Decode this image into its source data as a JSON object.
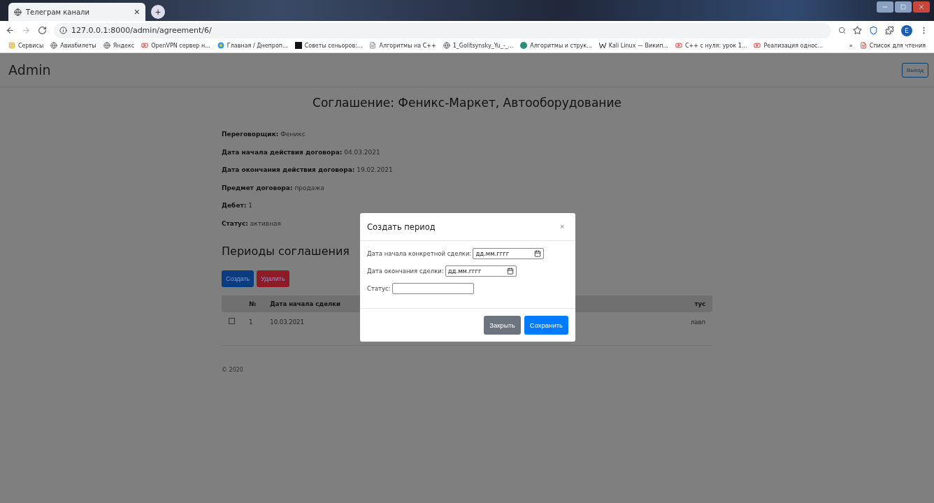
{
  "browser": {
    "tab": {
      "title": "Телеграм канали",
      "close": "×",
      "new_tab": "+"
    },
    "address": "127.0.0.1:8000/admin/agreement/6/",
    "bookmarks": [
      {
        "label": "Сервисы",
        "kind": "apps"
      },
      {
        "label": "Авиабилеты",
        "kind": "globe"
      },
      {
        "label": "Яндекс",
        "kind": "globe"
      },
      {
        "label": "OpenVPN сервер н...",
        "kind": "video"
      },
      {
        "label": "Главная / Днепроп...",
        "kind": "swirl"
      },
      {
        "label": "Советы сеньоров:...",
        "kind": "square"
      },
      {
        "label": "Алгоритмы на С++",
        "kind": "doc"
      },
      {
        "label": "1_Golitsynsky_Yu_-_...",
        "kind": "globe"
      },
      {
        "label": "Алгоритмы и струк...",
        "kind": "dot"
      },
      {
        "label": "Kali Linux — Викип...",
        "kind": "wiki"
      },
      {
        "label": "C++ с нуля: урок 1...",
        "kind": "video"
      },
      {
        "label": "Реализация однос...",
        "kind": "video"
      }
    ],
    "more": "»",
    "reading_list": "Список для чтения",
    "avatar": "E"
  },
  "navbar": {
    "brand": "Admin",
    "logout": "Выход"
  },
  "page": {
    "title": "Соглашение: Феникс-Маркет, Автооборудование",
    "fields": [
      {
        "label": "Переговорщик:",
        "value": "Феникс"
      },
      {
        "label": "Дата начала действия договора:",
        "value": "04.03.2021"
      },
      {
        "label": "Дата окончания действия договора:",
        "value": "19.02.2021"
      },
      {
        "label": "Предмет договора:",
        "value": "продажа"
      },
      {
        "label": "Дебет:",
        "value": "1"
      },
      {
        "label": "Статус:",
        "value": "активная"
      }
    ],
    "section_title": "Периоды соглашения",
    "buttons": [
      {
        "label": "Создать",
        "kind": "primary"
      },
      {
        "label": "Удалить",
        "kind": "danger"
      }
    ],
    "table": {
      "columns": [
        "№",
        "Дата начала сделки",
        "тус"
      ],
      "rows": [
        {
          "checked": false,
          "cells": [
            "1",
            "10.03.2021",
            "лавп"
          ]
        }
      ]
    },
    "footer": "© 2020"
  },
  "modal": {
    "title": "Создать период",
    "close": "×",
    "fields": [
      {
        "label": "Дата начала конкретной сделки:",
        "kind": "date",
        "placeholder": "дд.мм.гггг"
      },
      {
        "label": "Дата окончания сделки:",
        "kind": "date",
        "placeholder": "дд.мм.гггг"
      },
      {
        "label": "Статус:",
        "kind": "text"
      }
    ],
    "buttons": [
      {
        "label": "Закрыть",
        "kind": "secondary"
      },
      {
        "label": "Сохранить",
        "kind": "primary"
      }
    ]
  }
}
